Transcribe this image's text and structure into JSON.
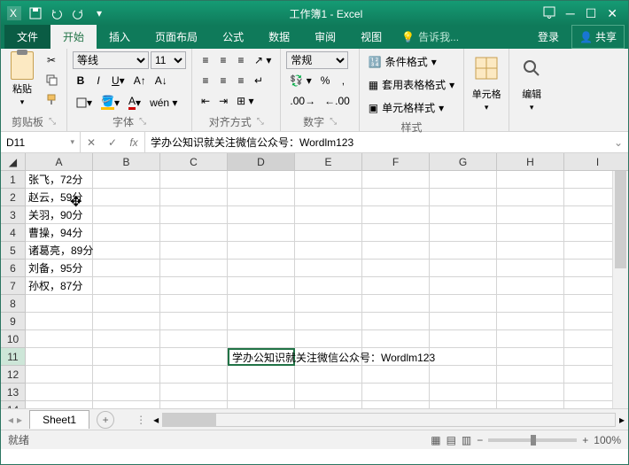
{
  "title": "工作簿1 - Excel",
  "tabs": {
    "file": "文件",
    "home": "开始",
    "insert": "插入",
    "layout": "页面布局",
    "formula": "公式",
    "data": "数据",
    "review": "审阅",
    "view": "视图",
    "tell": "告诉我...",
    "login": "登录",
    "share": "共享"
  },
  "groups": {
    "clipboard": "剪贴板",
    "font": "字体",
    "align": "对齐方式",
    "number": "数字",
    "style": "样式",
    "cells": "单元格",
    "edit": "编辑"
  },
  "paste_label": "粘贴",
  "font": {
    "name": "等线",
    "size": "11"
  },
  "number_format": "常规",
  "style_btns": {
    "cond": "条件格式",
    "table": "套用表格格式",
    "cell": "单元格样式"
  },
  "cells_btn": "单元格",
  "edit_btn": "编辑",
  "namebox": "D11",
  "formula_bar": "学办公知识就关注微信公众号：Wordlm123",
  "columns": [
    "A",
    "B",
    "C",
    "D",
    "E",
    "F",
    "G",
    "H",
    "I"
  ],
  "cells": {
    "A1": "张飞，72分",
    "A2": "赵云，59分",
    "A3": "关羽，90分",
    "A4": "曹操，94分",
    "A5": "诸葛亮，89分",
    "A6": "刘备，95分",
    "A7": "孙权，87分",
    "D11": "学办公知识就关注微信公众号：Wordlm123"
  },
  "chart_data": {
    "type": "table",
    "title": "",
    "records": [
      {
        "name": "张飞",
        "score": 72
      },
      {
        "name": "赵云",
        "score": 59
      },
      {
        "name": "关羽",
        "score": 90
      },
      {
        "name": "曹操",
        "score": 94
      },
      {
        "name": "诸葛亮",
        "score": 89
      },
      {
        "name": "刘备",
        "score": 95
      },
      {
        "name": "孙权",
        "score": 87
      }
    ]
  },
  "sheet": "Sheet1",
  "status": "就绪",
  "zoom": "100%"
}
